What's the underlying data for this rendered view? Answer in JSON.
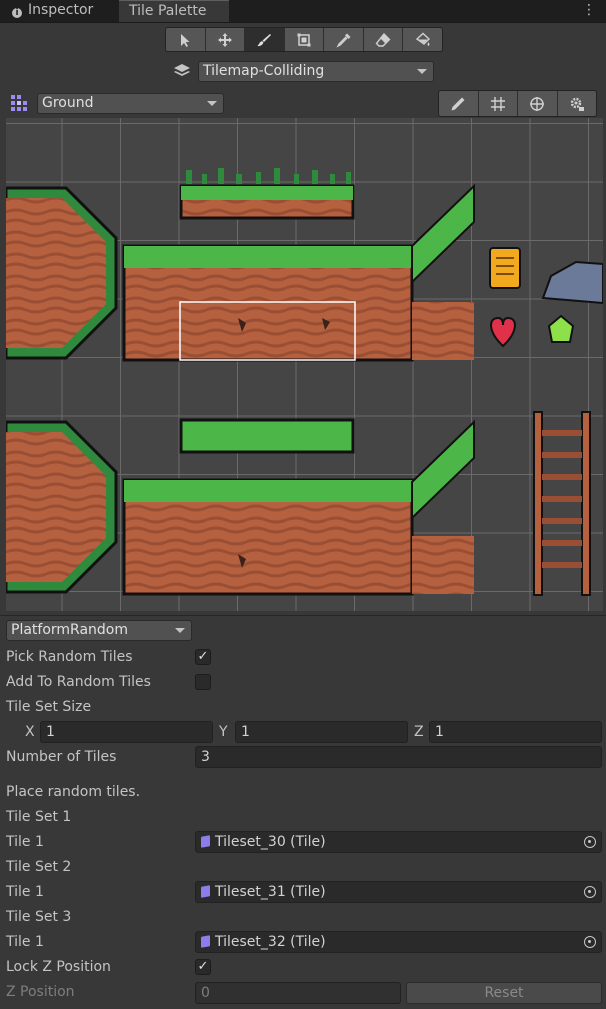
{
  "tabs": [
    {
      "label": "Inspector",
      "active": false
    },
    {
      "label": "Tile Palette",
      "active": true
    }
  ],
  "toolbar": {
    "tools": [
      "select-icon",
      "move-icon",
      "brush-icon",
      "box-fill-icon",
      "picker-icon",
      "eraser-icon",
      "fill-icon"
    ],
    "selected": "brush-icon"
  },
  "tilemap_dropdown": {
    "value": "Tilemap-Colliding"
  },
  "palette_dropdown": {
    "value": "Ground"
  },
  "palette_tools": [
    "edit-icon",
    "grid-icon",
    "gizmo-icon",
    "settings-icon"
  ],
  "brush_dropdown": {
    "value": "PlatformRandom"
  },
  "fields": {
    "pick_random_tiles": {
      "label": "Pick Random Tiles",
      "checked": true
    },
    "add_to_random_tiles": {
      "label": "Add To Random Tiles",
      "checked": false
    },
    "tile_set_size": {
      "label": "Tile Set Size",
      "x_label": "X",
      "x": "1",
      "y_label": "Y",
      "y": "1",
      "z_label": "Z",
      "z": "1"
    },
    "number_of_tiles": {
      "label": "Number of Tiles",
      "value": "3"
    },
    "place_random": "Place random tiles.",
    "tile_sets": [
      {
        "header": "Tile Set 1",
        "tile_label": "Tile 1",
        "value": "Tileset_30 (Tile)"
      },
      {
        "header": "Tile Set 2",
        "tile_label": "Tile 1",
        "value": "Tileset_31 (Tile)"
      },
      {
        "header": "Tile Set 3",
        "tile_label": "Tile 1",
        "value": "Tileset_32 (Tile)"
      }
    ],
    "lock_z": {
      "label": "Lock Z Position",
      "checked": true
    },
    "z_position": {
      "label": "Z Position",
      "value": "0",
      "reset_label": "Reset"
    }
  },
  "colors": {
    "grass": "#4cb648",
    "dirt": "#b5603f",
    "dirt_dark": "#8a4430",
    "grid": "#6a6a6a",
    "selection": "#ffffff"
  }
}
